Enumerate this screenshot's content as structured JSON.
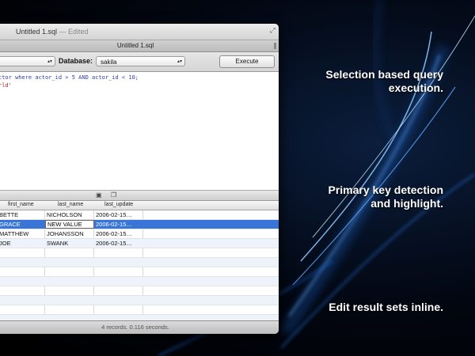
{
  "window": {
    "title": "Untitled 1.sql",
    "title_suffix": " — Edited",
    "resize_glyph": "⤢",
    "tab_label": "Untitled 1.sql"
  },
  "toolbar": {
    "connection_popup": "",
    "database_label": "Database:",
    "database_value": "sakila",
    "execute_label": "Execute",
    "popup_arrows": "▴▾"
  },
  "editor": {
    "line1": "ctor where actor_id > 5 AND actor_id < 10;",
    "line2": "rld'"
  },
  "results": {
    "columns": [
      "first_name",
      "last_name",
      "last_update"
    ],
    "rows": [
      [
        "BETTE",
        "NICHOLSON",
        "2006-02-15…"
      ],
      [
        "GRACE",
        "NEW VALUE",
        "2006-02-15…"
      ],
      [
        "MATTHEW",
        "JOHANSSON",
        "2006-02-15…"
      ],
      [
        "JOE",
        "SWANK",
        "2006-02-15…"
      ]
    ],
    "selected_row": 1,
    "editing_cell": "NEW VALUE",
    "status": "4 records. 0.116 seconds."
  },
  "splitbar": {
    "icons": [
      "folder-icon",
      "copy-icon"
    ],
    "folder_glyph": "▣",
    "copy_glyph": "❐"
  },
  "captions": {
    "caption1_line1": "Selection based query",
    "caption1_line2": "execution.",
    "caption2_line1": "Primary key detection",
    "caption2_line2": "and highlight.",
    "caption3_line1": "Edit result sets inline."
  },
  "colors": {
    "selection": "#3875d7",
    "caption_text": "#ffffff",
    "streak": "#4aa3ff"
  }
}
